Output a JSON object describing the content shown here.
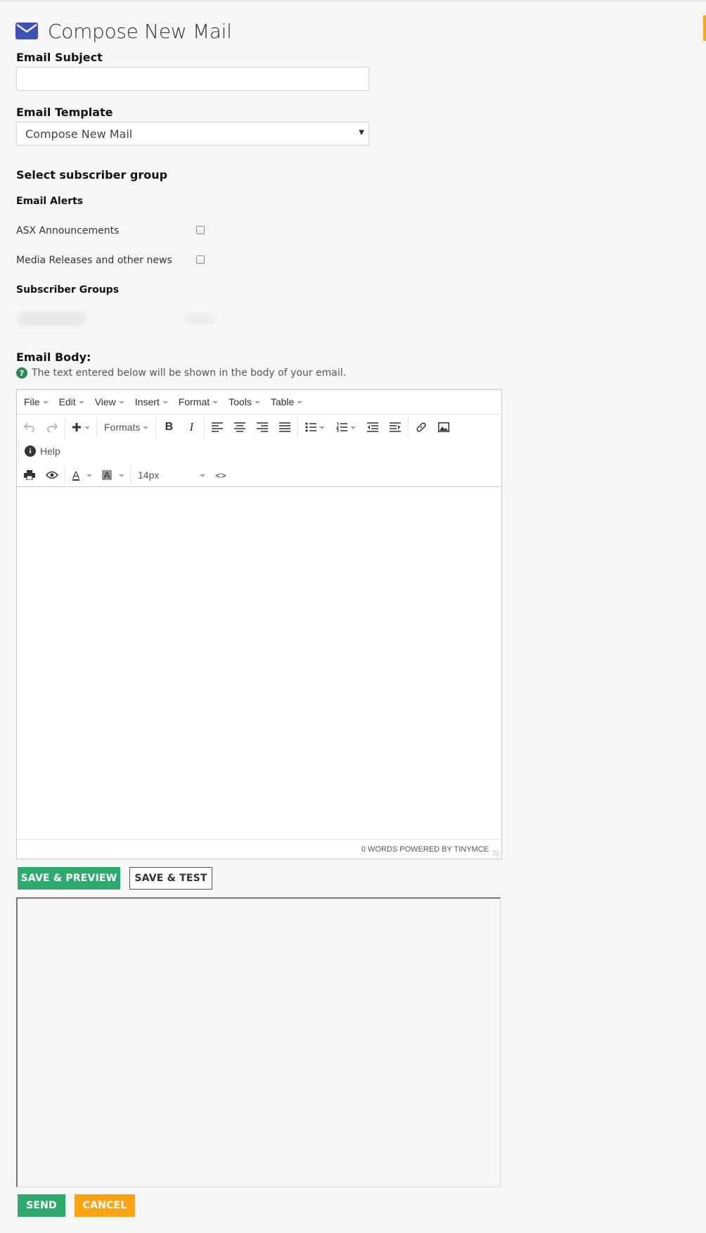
{
  "page": {
    "title": "Compose New Mail",
    "icon": "envelope-icon"
  },
  "colors": {
    "accent": "#f7a51c",
    "primary_green": "#2eaa6e",
    "orange": "#fca311",
    "icon_blue": "#3f51b5",
    "help_green": "#2e8b57"
  },
  "form": {
    "subject": {
      "label": "Email Subject",
      "value": ""
    },
    "template": {
      "label": "Email Template",
      "selected": "Compose New Mail"
    },
    "subscriber_section_title": "Select subscriber group",
    "email_alerts": {
      "title": "Email Alerts",
      "options": [
        {
          "label": "ASX Announcements",
          "checked": false
        },
        {
          "label": "Media Releases and other news",
          "checked": false
        }
      ]
    },
    "subscriber_groups_title": "Subscriber Groups",
    "body": {
      "label": "Email Body:",
      "help": "The text entered below will be shown in the body of your email."
    }
  },
  "editor": {
    "menus": [
      "File",
      "Edit",
      "View",
      "Insert",
      "Format",
      "Tools",
      "Table"
    ],
    "formats_label": "Formats",
    "help_label": "Help",
    "font_size": "14px",
    "status": "0 WORDS POWERED BY TINYMCE"
  },
  "buttons": {
    "save_preview": "SAVE & PREVIEW",
    "save_test": "SAVE & TEST",
    "send": "SEND",
    "cancel": "CANCEL"
  }
}
